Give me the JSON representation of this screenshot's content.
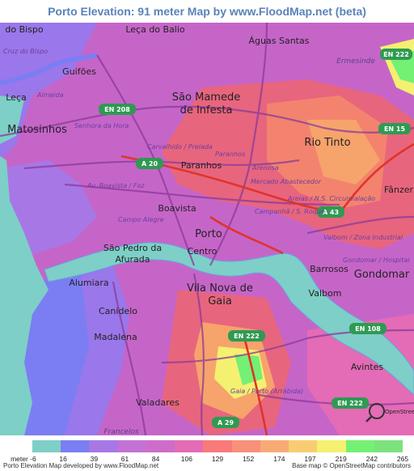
{
  "title": "Porto Elevation: 91 meter Map by www.FloodMap.net (beta)",
  "map": {
    "places_large": [
      {
        "label": "Porto"
      },
      {
        "label": "São Mamede"
      },
      {
        "label": "de Infesta"
      },
      {
        "label": "Rio Tinto"
      },
      {
        "label": "Vila Nova de"
      },
      {
        "label": "Gaia"
      },
      {
        "label": "Gondomar"
      },
      {
        "label": "Matosinhos"
      }
    ],
    "places_medium": [
      {
        "label": "do Bispo"
      },
      {
        "label": "Leça do Balio"
      },
      {
        "label": "Águas Santas"
      },
      {
        "label": "Guifões"
      },
      {
        "label": "Paranhos"
      },
      {
        "label": "Boavista"
      },
      {
        "label": "São Pedro da"
      },
      {
        "label": "Afurada"
      },
      {
        "label": "Centro"
      },
      {
        "label": "Alumiara"
      },
      {
        "label": "Canidelo"
      },
      {
        "label": "Madalena"
      },
      {
        "label": "Barrosos"
      },
      {
        "label": "Valbom"
      },
      {
        "label": "Avintes"
      },
      {
        "label": "Valadares"
      },
      {
        "label": "Fânzer"
      },
      {
        "label": "Leça"
      },
      {
        "label": "Ermesinde"
      },
      {
        "label": "Francelos"
      }
    ],
    "places_small": [
      {
        "label": "Senhora da Hora"
      },
      {
        "label": "Carvalhido / Prelada"
      },
      {
        "label": "Paranhos"
      },
      {
        "label": "Arenosa"
      },
      {
        "label": "Mercado Abastecedor"
      },
      {
        "label": "Av. Boavista / Foz"
      },
      {
        "label": "Campo Alegre"
      },
      {
        "label": "Campanhã / S. Roque"
      },
      {
        "label": "Areias / N.S. Circunvalação"
      },
      {
        "label": "Valbom / Zona Industrial"
      },
      {
        "label": "Gondomar / Hospital"
      },
      {
        "label": "Gaia / Porto (Arrábida)"
      },
      {
        "label": "Cruz do Bispo"
      },
      {
        "label": "Almeida"
      }
    ],
    "roads": [
      {
        "label": "EN 208"
      },
      {
        "label": "EN 15"
      },
      {
        "label": "A 20"
      },
      {
        "label": "A 43"
      },
      {
        "label": "EN 222"
      },
      {
        "label": "EN 108"
      },
      {
        "label": "A 29"
      },
      {
        "label": "EN 222"
      },
      {
        "label": "EN 222"
      }
    ],
    "osm_logo_text": "OpenStreetMap"
  },
  "legend": {
    "unit": "meter",
    "values": [
      "-6",
      "16",
      "39",
      "61",
      "84",
      "106",
      "129",
      "152",
      "174",
      "197",
      "219",
      "242",
      "265"
    ],
    "colors": [
      "#7dcfc7",
      "#7b7ef2",
      "#a877e6",
      "#c471d6",
      "#cf6cc9",
      "#e46bb5",
      "#f87a7a",
      "#f8907a",
      "#f8aa76",
      "#f8cd72",
      "#f4f070",
      "#74f074",
      "#7ce27c"
    ]
  },
  "credits": {
    "left": "Porto Elevation Map developed by www.FloodMap.net",
    "right": "Base map © OpenStreetMap contributors"
  }
}
